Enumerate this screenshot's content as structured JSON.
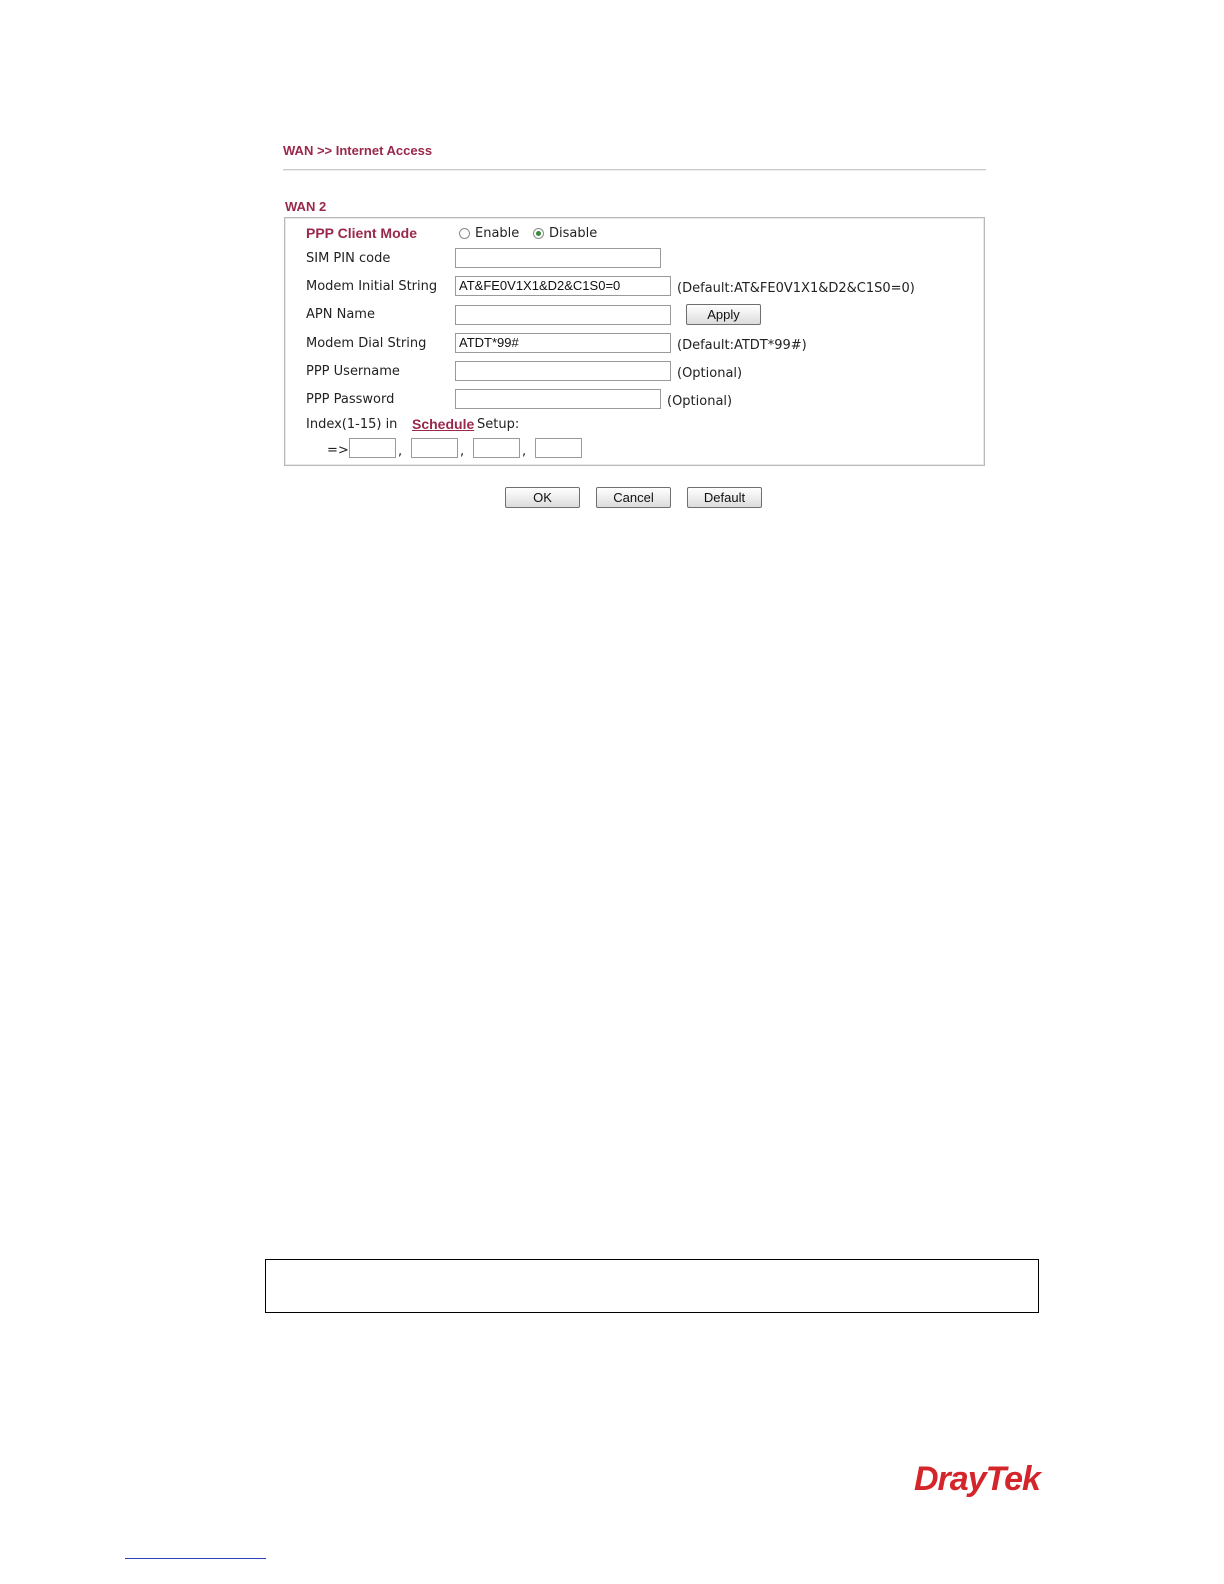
{
  "header": {
    "breadcrumb": "WAN >> Internet Access"
  },
  "section": {
    "title": "WAN 2"
  },
  "form": {
    "ppp_client_mode": {
      "label": "PPP Client Mode",
      "enable": "Enable",
      "disable": "Disable",
      "selected": "Disable"
    },
    "sim_pin": {
      "label": "SIM PIN code",
      "value": ""
    },
    "modem_initial_string": {
      "label": "Modem Initial String",
      "value": "AT&FE0V1X1&D2&C1S0=0",
      "hint": "(Default:AT&FE0V1X1&D2&C1S0=0)"
    },
    "apn_name": {
      "label": "APN Name",
      "value": "",
      "apply": "Apply"
    },
    "modem_dial_string": {
      "label": "Modem Dial String",
      "value": "ATDT*99#",
      "hint": "(Default:ATDT*99#)"
    },
    "ppp_username": {
      "label": "PPP Username",
      "value": "",
      "hint": "(Optional)"
    },
    "ppp_password": {
      "label": "PPP Password",
      "value": "",
      "hint": "(Optional)"
    },
    "schedule": {
      "prefix": "Index(1-15) in",
      "link": "Schedule",
      "suffix": "Setup:",
      "arrow": "=>",
      "separator": ",",
      "values": [
        "",
        "",
        "",
        ""
      ]
    }
  },
  "buttons": {
    "ok": "OK",
    "cancel": "Cancel",
    "default": "Default"
  },
  "brand": {
    "logo": "DrayTek",
    "color": "#d4262a"
  },
  "colors": {
    "accent": "#99284a"
  }
}
